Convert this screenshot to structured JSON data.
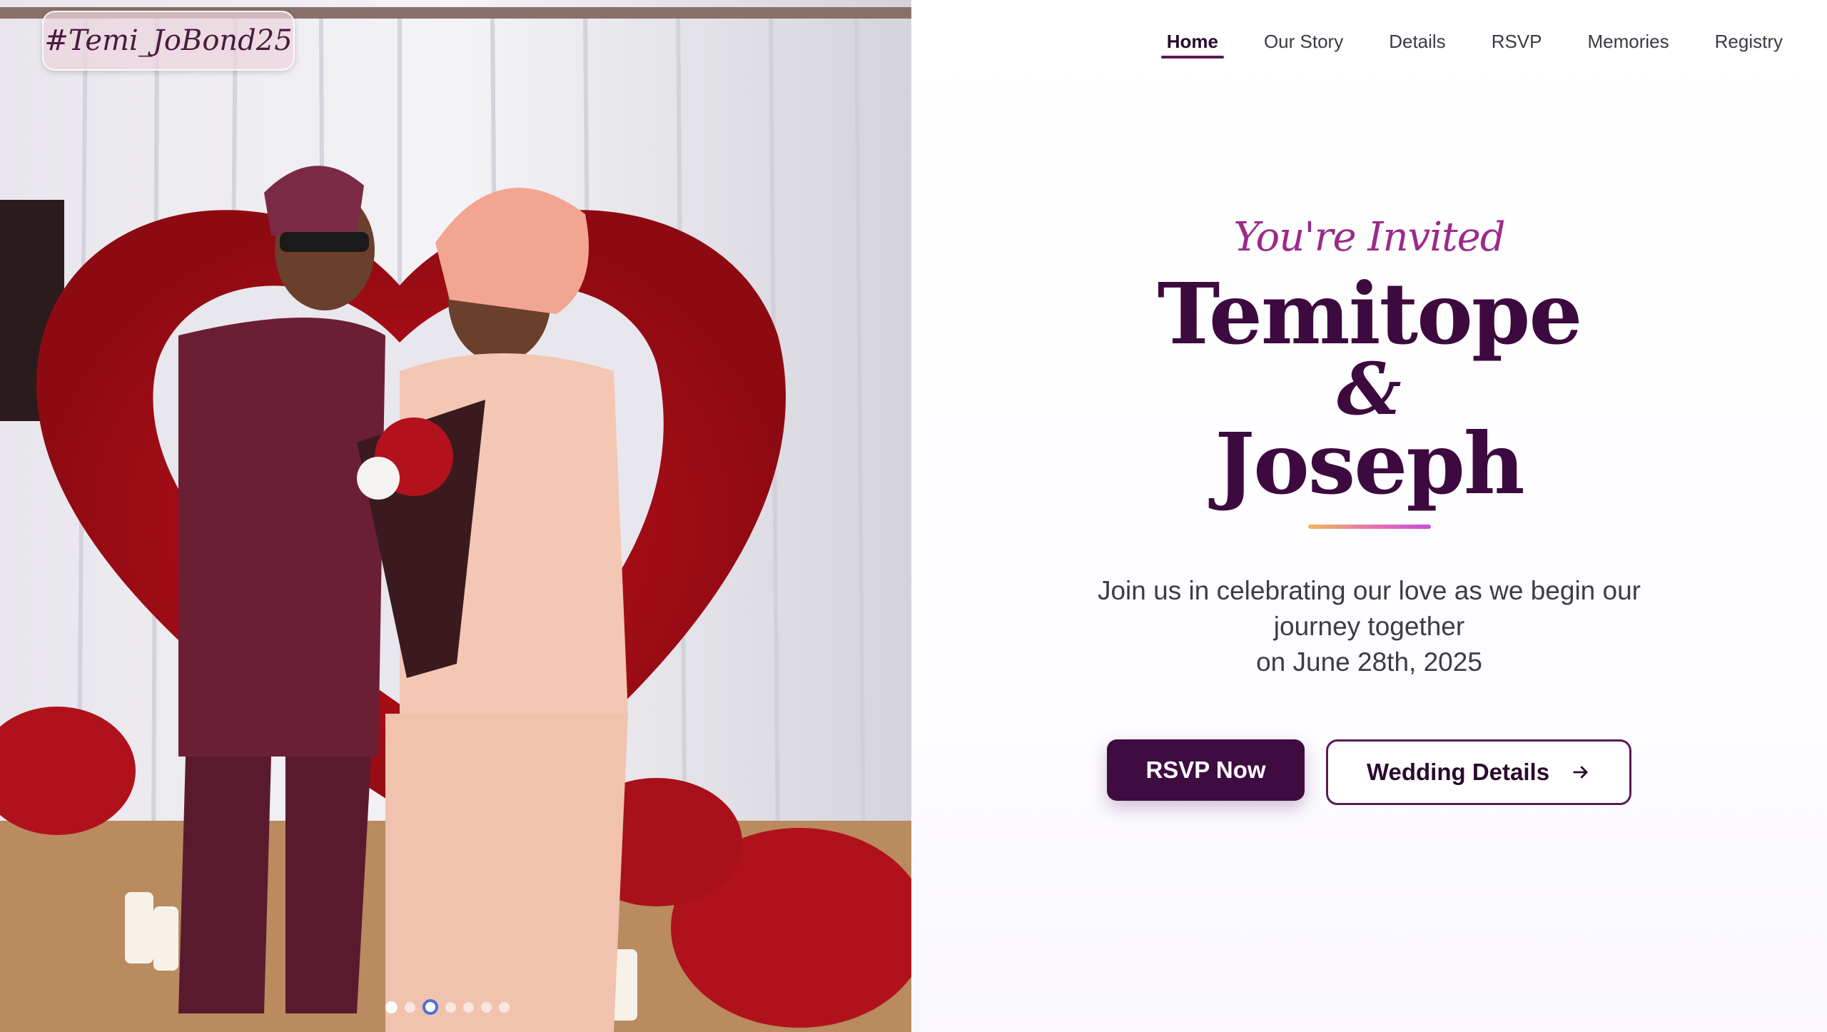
{
  "hashtag": "#Temi_JoBond25",
  "nav": {
    "items": [
      {
        "label": "Home",
        "active": true
      },
      {
        "label": "Our Story",
        "active": false
      },
      {
        "label": "Details",
        "active": false
      },
      {
        "label": "RSVP",
        "active": false
      },
      {
        "label": "Memories",
        "active": false
      },
      {
        "label": "Registry",
        "active": false
      }
    ]
  },
  "hero": {
    "invited": "You're Invited",
    "name_one": "Temitope",
    "ampersand": "&",
    "name_two": "Joseph",
    "tagline_line1": "Join us in celebrating our love as we begin our journey together",
    "tagline_line2": "on June 28th, 2025"
  },
  "buttons": {
    "rsvp_label": "RSVP Now",
    "details_label": "Wedding Details"
  },
  "carousel": {
    "slide_count": 7,
    "active_index": 2
  },
  "colors": {
    "brand_plum": "#3f0c42",
    "accent_magenta": "#9c2a8a",
    "carousel_active": "#4a6fe0"
  },
  "icons": {
    "details_arrow": "arrow-right-icon"
  }
}
